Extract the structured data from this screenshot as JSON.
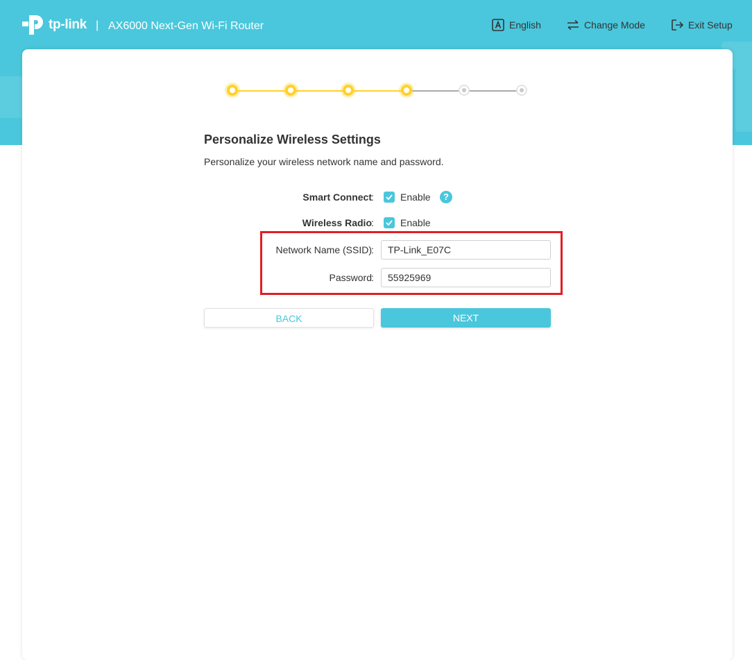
{
  "header": {
    "logo_text": "tp-link",
    "separator": "|",
    "model": "AX6000 Next-Gen Wi-Fi Router",
    "actions": [
      {
        "label": "English",
        "icon": "language-icon"
      },
      {
        "label": "Change Mode",
        "icon": "swap-arrows-icon"
      },
      {
        "label": "Exit Setup",
        "icon": "exit-icon"
      }
    ]
  },
  "stepper": {
    "total_steps": 6,
    "completed_steps": 4,
    "active_color": "#ffd12a",
    "inactive_color": "#c9c9c9"
  },
  "main": {
    "title": "Personalize Wireless Settings",
    "subtitle": "Personalize your wireless network name and password.",
    "smart_connect": {
      "label": "Smart Connect",
      "colon": ":",
      "checkbox_label": "Enable",
      "checked": true,
      "help_icon": "?"
    },
    "wireless_radio": {
      "label": "Wireless Radio",
      "colon": ":",
      "checkbox_label": "Enable",
      "checked": true
    },
    "ssid": {
      "label": "Network Name (SSID)",
      "colon": ":",
      "value": "TP-Link_E07C"
    },
    "password": {
      "label": "Password",
      "colon": ":",
      "value": "55925969"
    },
    "back_label": "BACK",
    "next_label": "NEXT"
  },
  "colors": {
    "brand": "#4ac7dc",
    "highlight_box": "#e11d25"
  }
}
